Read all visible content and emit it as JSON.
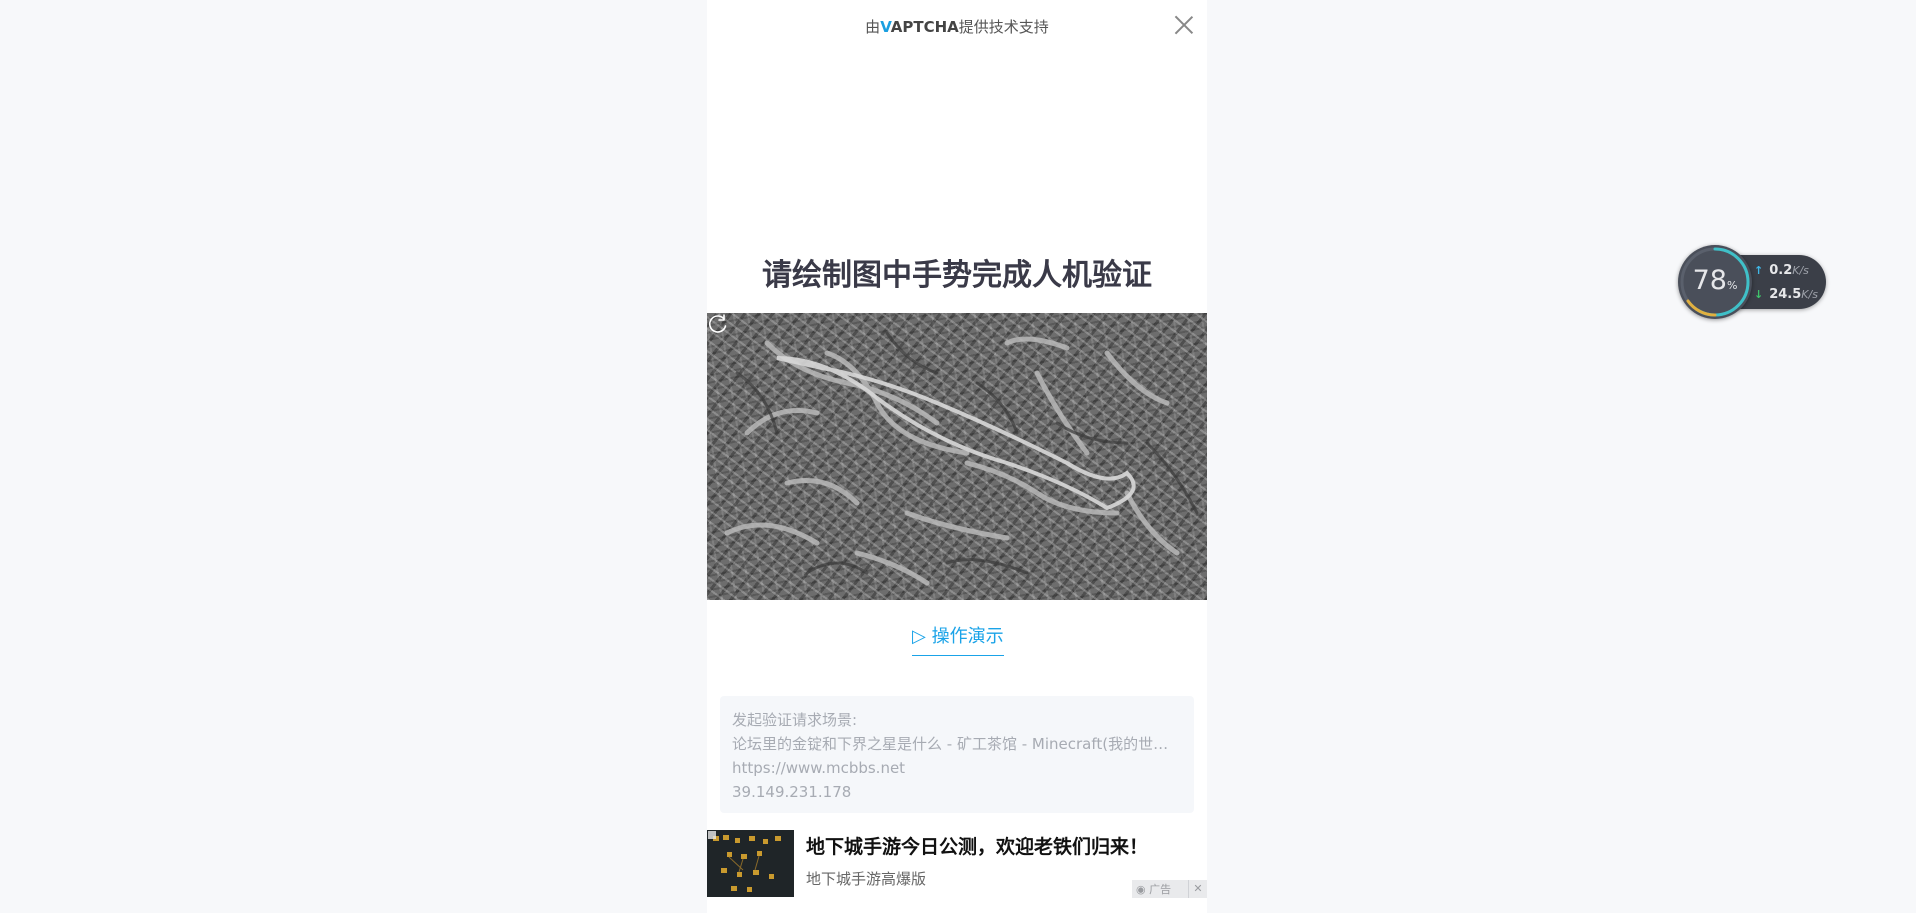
{
  "header": {
    "powered_prefix": "由",
    "brand_v": "V",
    "brand_rest": "APTCHA",
    "powered_suffix": "提供技术支持"
  },
  "captcha": {
    "title": "请绘制图中手势完成人机验证",
    "demo_link": "▷ 操作演示"
  },
  "request_info": {
    "label": "发起验证请求场景:",
    "page_title": "论坛里的金锭和下界之星是什么 - 矿工茶馆 - Minecraft(我的世界...",
    "url": "https://www.mcbbs.net",
    "ip": "39.149.231.178"
  },
  "ad": {
    "title": "地下城手游今日公测，欢迎老铁们归来！",
    "subtitle": "地下城手游高爆版",
    "badge_label": "广告",
    "close_glyph": "✕"
  },
  "net_monitor": {
    "percent": "78",
    "percent_unit": "%",
    "upload_value": "0.2",
    "upload_unit": "K/s",
    "download_value": "24.5",
    "download_unit": "K/s",
    "ring_progress": 0.78,
    "colors": {
      "upload_arrow": "#3fb8e8",
      "download_arrow": "#3fc46b"
    }
  },
  "icons": {
    "close": "close-icon",
    "refresh": "refresh-icon",
    "play": "play-icon"
  }
}
